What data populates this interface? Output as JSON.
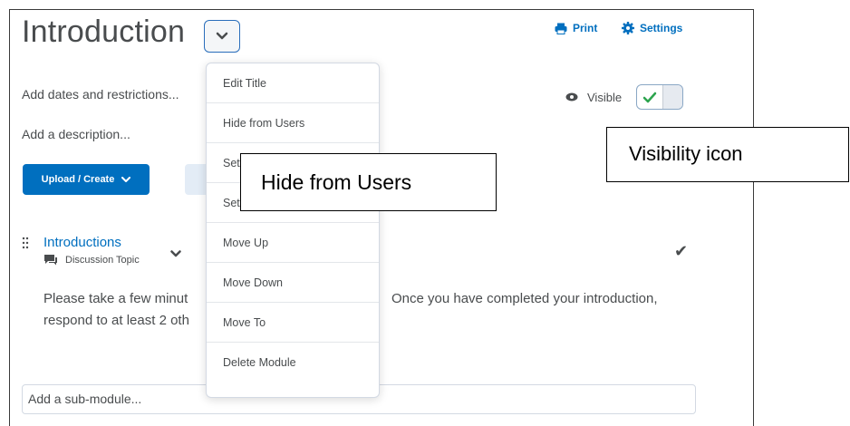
{
  "module": {
    "title": "Introduction"
  },
  "actions": {
    "print": "Print",
    "settings": "Settings"
  },
  "meta": {
    "dates": "Add dates and restrictions...",
    "description": "Add a description..."
  },
  "visibility": {
    "label": "Visible",
    "state": "on"
  },
  "buttons": {
    "upload_create": "Upload / Create"
  },
  "topic": {
    "title": "Introductions",
    "type": "Discussion Topic",
    "body_line1_left": "Please take a few minut",
    "body_line1_right": "Once you have completed your introduction,",
    "body_line2": "respond to at least 2 oth"
  },
  "submodule": {
    "placeholder": "Add a sub-module..."
  },
  "menu": {
    "items": [
      "Edit Title",
      "Hide from Users",
      "Set",
      "Set All Completion",
      "Move Up",
      "Move Down",
      "Move To",
      "Delete Module"
    ]
  },
  "callouts": {
    "hide": "Hide from Users",
    "visibility": "Visibility icon"
  },
  "colors": {
    "accent": "#006fbf",
    "check_green": "#2da44e",
    "text": "#494c4e"
  }
}
